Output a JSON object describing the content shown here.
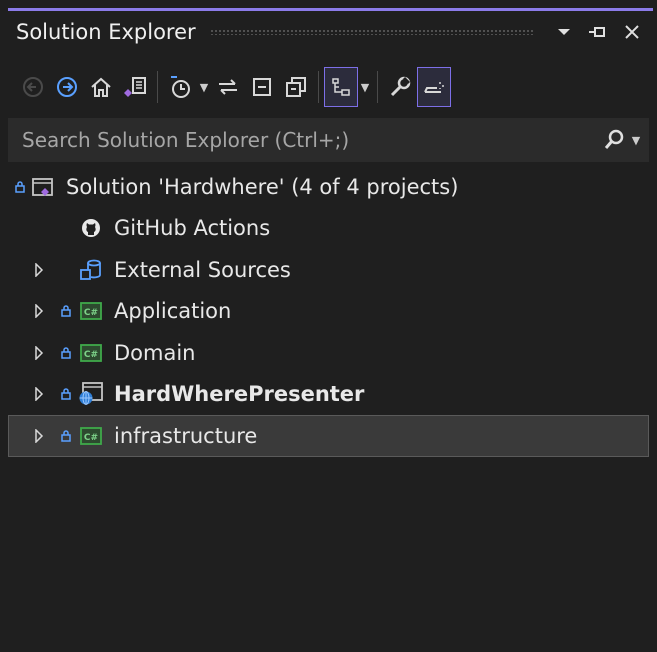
{
  "window": {
    "title": "Solution Explorer",
    "buttons": {
      "dropdown_icon": "chevron-down-icon",
      "pin_icon": "pin-icon",
      "close_icon": "close-icon"
    }
  },
  "toolbar": {
    "items": [
      {
        "name": "back-button",
        "icon": "back-arrow-icon",
        "state": "disabled"
      },
      {
        "name": "forward-button",
        "icon": "forward-arrow-icon",
        "state": "enabled"
      },
      {
        "name": "home-button",
        "icon": "home-icon"
      },
      {
        "name": "switch-views-button",
        "icon": "switch-views-icon"
      },
      {
        "name": "pending-changes-filter-button",
        "icon": "clock-icon"
      },
      {
        "name": "sync-active-document-button",
        "icon": "sync-arrows-icon"
      },
      {
        "name": "collapse-all-button",
        "icon": "collapse-all-icon"
      },
      {
        "name": "show-all-files-button",
        "icon": "show-all-files-icon"
      },
      {
        "name": "view-button",
        "icon": "class-view-icon",
        "selected": true
      },
      {
        "name": "properties-button",
        "icon": "wrench-icon"
      },
      {
        "name": "preview-selected-items-button",
        "icon": "preview-icon",
        "selected": true
      }
    ]
  },
  "search": {
    "placeholder": "Search Solution Explorer (Ctrl+;)",
    "value": ""
  },
  "tree": {
    "items": [
      {
        "label": "Solution 'Hardwhere' (4 of 4 projects)",
        "icon": "solution-icon",
        "locked": true,
        "expander": false,
        "indent": 0,
        "bold": false
      },
      {
        "label": "GitHub Actions",
        "icon": "github-icon",
        "locked": false,
        "expander": false,
        "indent": 1,
        "bold": false
      },
      {
        "label": "External Sources",
        "icon": "external-sources-icon",
        "locked": false,
        "expander": true,
        "indent": 1,
        "bold": false
      },
      {
        "label": "Application",
        "icon": "csharp-project-icon",
        "locked": true,
        "expander": true,
        "indent": 1,
        "bold": false
      },
      {
        "label": "Domain",
        "icon": "csharp-project-icon",
        "locked": true,
        "expander": true,
        "indent": 1,
        "bold": false
      },
      {
        "label": "HardWherePresenter",
        "icon": "web-project-icon",
        "locked": true,
        "expander": true,
        "indent": 1,
        "bold": true
      },
      {
        "label": "infrastructure",
        "icon": "csharp-project-icon",
        "locked": true,
        "expander": true,
        "indent": 1,
        "bold": false,
        "selected": true
      }
    ]
  },
  "colors": {
    "background": "#1f1f1f",
    "accent": "#8b7be9",
    "search_bg": "#2b2b2b",
    "selection_bg": "#3a3a3a",
    "lock": "#5aa0ff",
    "csharp_green": "#3fa94a"
  }
}
